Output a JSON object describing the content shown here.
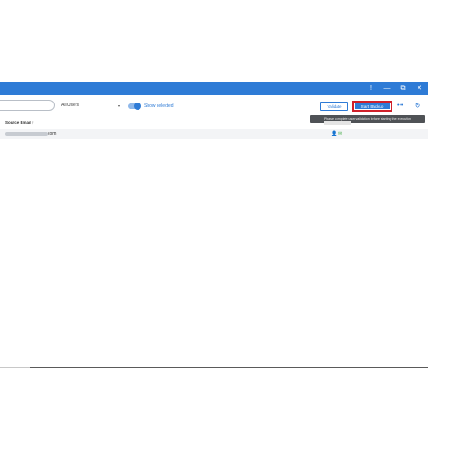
{
  "titlebar": {
    "controls": {
      "info": "!",
      "minimize": "—",
      "restore": "⧉",
      "close": "✕"
    }
  },
  "toolbar": {
    "user_filter": {
      "value": "All Users",
      "caret": "▾"
    },
    "toggle": {
      "label": "Show selected",
      "state": "on"
    },
    "validate_label": "Validate",
    "start_backup_label": "Start Backup",
    "more_label": "•••",
    "refresh_glyph": "↻"
  },
  "tooltip": {
    "text": "Please complete user validation before starting the execution"
  },
  "table": {
    "headers": {
      "source_email": "Source Email ↑"
    },
    "rows": [
      {
        "email_visible_suffix": "com",
        "icons": {
          "user": "👤",
          "mail": "✉"
        }
      }
    ]
  },
  "colors": {
    "accent": "#2e7bd6",
    "highlight_border": "#d0202a",
    "tooltip_bg": "#4f5256",
    "status_green": "#4caf50"
  }
}
